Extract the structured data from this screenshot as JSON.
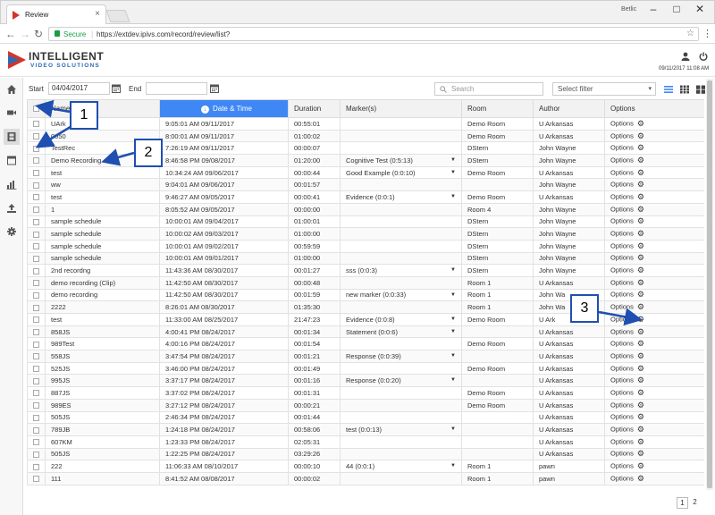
{
  "browser": {
    "tab_title": "Review",
    "window_user": "Betlic",
    "secure_label": "Secure",
    "url": "https://extdev.ipivs.com/record/review/list?"
  },
  "app": {
    "brand_line1": "INTELLIGENT",
    "brand_line2": "VIDEO SOLUTIONS",
    "datetime": "09/11/2017 11:08 AM"
  },
  "filters": {
    "start_label": "Start",
    "start_value": "04/04/2017",
    "end_label": "End",
    "end_value": "",
    "search_placeholder": "Search",
    "select_filter": "Select filter"
  },
  "table": {
    "headers": {
      "name": "Name",
      "datetime": "Date & Time",
      "duration": "Duration",
      "markers": "Marker(s)",
      "room": "Room",
      "author": "Author",
      "options": "Options"
    },
    "options_label": "Options",
    "rows": [
      {
        "name": "UArk",
        "datetime": "9:05:01 AM 09/11/2017",
        "duration": "00:55:01",
        "markers": "",
        "room": "Demo Room",
        "author": "U Arkansas"
      },
      {
        "name": "0050",
        "datetime": "8:00:01 AM 09/11/2017",
        "duration": "01:00:02",
        "markers": "",
        "room": "Demo Room",
        "author": "U Arkansas"
      },
      {
        "name": "TestRec",
        "datetime": "7:26:19 AM 09/11/2017",
        "duration": "00:00:07",
        "markers": "",
        "room": "DStern",
        "author": "John Wayne"
      },
      {
        "name": "Demo Recording",
        "datetime": "8:46:58 PM 09/08/2017",
        "duration": "01:20:00",
        "markers": "Cognitive Test (0:5:13)",
        "room": "DStern",
        "author": "John Wayne"
      },
      {
        "name": "test",
        "datetime": "10:34:24 AM 09/06/2017",
        "duration": "00:00:44",
        "markers": "Good Example (0:0:10)",
        "room": "Demo Room",
        "author": "U Arkansas"
      },
      {
        "name": "ww",
        "datetime": "9:04:01 AM 09/06/2017",
        "duration": "00:01:57",
        "markers": "",
        "room": "",
        "author": "John Wayne"
      },
      {
        "name": "test",
        "datetime": "9:46:27 AM 09/05/2017",
        "duration": "00:00:41",
        "markers": "Evidence (0:0:1)",
        "room": "Demo Room",
        "author": "U Arkansas"
      },
      {
        "name": "1",
        "datetime": "8:05:52 AM 09/05/2017",
        "duration": "00:00:00",
        "markers": "",
        "room": "Room 4",
        "author": "John Wayne"
      },
      {
        "name": "sample schedule",
        "datetime": "10:00:01 AM 09/04/2017",
        "duration": "01:00:01",
        "markers": "",
        "room": "DStern",
        "author": "John Wayne"
      },
      {
        "name": "sample schedule",
        "datetime": "10:00:02 AM 09/03/2017",
        "duration": "01:00:00",
        "markers": "",
        "room": "DStern",
        "author": "John Wayne"
      },
      {
        "name": "sample schedule",
        "datetime": "10:00:01 AM 09/02/2017",
        "duration": "00:59:59",
        "markers": "",
        "room": "DStern",
        "author": "John Wayne"
      },
      {
        "name": "sample schedule",
        "datetime": "10:00:01 AM 09/01/2017",
        "duration": "01:00:00",
        "markers": "",
        "room": "DStern",
        "author": "John Wayne"
      },
      {
        "name": "2nd recordng",
        "datetime": "11:43:36 AM 08/30/2017",
        "duration": "00:01:27",
        "markers": "sss (0:0:3)",
        "room": "DStern",
        "author": "John Wayne"
      },
      {
        "name": "demo recording (Clip)",
        "datetime": "11:42:50 AM 08/30/2017",
        "duration": "00:00:48",
        "markers": "",
        "room": "Room 1",
        "author": "U Arkansas"
      },
      {
        "name": "demo recording",
        "datetime": "11:42:50 AM 08/30/2017",
        "duration": "00:01:59",
        "markers": "new marker (0:0:33)",
        "room": "Room 1",
        "author": "John Wa"
      },
      {
        "name": "2222",
        "datetime": "8:26:01 AM 08/30/2017",
        "duration": "01:35:30",
        "markers": "",
        "room": "Room 1",
        "author": "John Wa"
      },
      {
        "name": "test",
        "datetime": "11:33:00 AM 08/25/2017",
        "duration": "21:47:23",
        "markers": "Evidence (0:0:8)",
        "room": "Demo Room",
        "author": "U Ark"
      },
      {
        "name": "858JS",
        "datetime": "4:00:41 PM 08/24/2017",
        "duration": "00:01:34",
        "markers": "Statement (0:0:6)",
        "room": "",
        "author": "U Arkansas"
      },
      {
        "name": "989Test",
        "datetime": "4:00:16 PM 08/24/2017",
        "duration": "00:01:54",
        "markers": "",
        "room": "Demo Room",
        "author": "U Arkansas"
      },
      {
        "name": "558JS",
        "datetime": "3:47:54 PM 08/24/2017",
        "duration": "00:01:21",
        "markers": "Response (0:0:39)",
        "room": "",
        "author": "U Arkansas"
      },
      {
        "name": "525JS",
        "datetime": "3:46:00 PM 08/24/2017",
        "duration": "00:01:49",
        "markers": "",
        "room": "Demo Room",
        "author": "U Arkansas"
      },
      {
        "name": "995JS",
        "datetime": "3:37:17 PM 08/24/2017",
        "duration": "00:01:16",
        "markers": "Response (0:0:20)",
        "room": "",
        "author": "U Arkansas"
      },
      {
        "name": "887JS",
        "datetime": "3:37:02 PM 08/24/2017",
        "duration": "00:01:31",
        "markers": "",
        "room": "Demo Room",
        "author": "U Arkansas"
      },
      {
        "name": "989ES",
        "datetime": "3:27:12 PM 08/24/2017",
        "duration": "00:00:21",
        "markers": "",
        "room": "Demo Room",
        "author": "U Arkansas"
      },
      {
        "name": "505JS",
        "datetime": "2:46:34 PM 08/24/2017",
        "duration": "00:01:44",
        "markers": "",
        "room": "",
        "author": "U Arkansas"
      },
      {
        "name": "789JB",
        "datetime": "1:24:18 PM 08/24/2017",
        "duration": "00:58:06",
        "markers": "test (0:0:13)",
        "room": "",
        "author": "U Arkansas"
      },
      {
        "name": "607KM",
        "datetime": "1:23:33 PM 08/24/2017",
        "duration": "02:05:31",
        "markers": "",
        "room": "",
        "author": "U Arkansas"
      },
      {
        "name": "505JS",
        "datetime": "1:22:25 PM 08/24/2017",
        "duration": "03:29:26",
        "markers": "",
        "room": "",
        "author": "U Arkansas"
      },
      {
        "name": "222",
        "datetime": "11:06:33 AM 08/10/2017",
        "duration": "00:00:10",
        "markers": "44 (0:0:1)",
        "room": "Room 1",
        "author": "pawn"
      },
      {
        "name": "111",
        "datetime": "8:41:52 AM 08/08/2017",
        "duration": "00:00:02",
        "markers": "",
        "room": "Room 1",
        "author": "pawn"
      }
    ]
  },
  "pagination": {
    "page1": "1",
    "page2": "2"
  },
  "callouts": {
    "c1": "1",
    "c2": "2",
    "c3": "3"
  },
  "colors": {
    "accent": "#3f87f5",
    "callout_border": "#1f4fb0",
    "secure": "#1a9e3f"
  }
}
